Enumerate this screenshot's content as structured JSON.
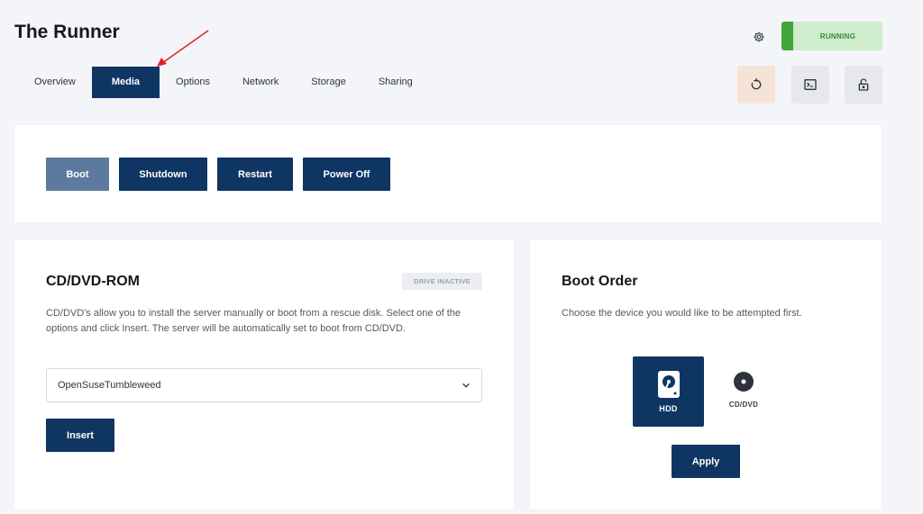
{
  "app": {
    "title": "The Runner"
  },
  "tabs": [
    {
      "label": "Overview",
      "active": false
    },
    {
      "label": "Media",
      "active": true
    },
    {
      "label": "Options",
      "active": false
    },
    {
      "label": "Network",
      "active": false
    },
    {
      "label": "Storage",
      "active": false
    },
    {
      "label": "Sharing",
      "active": false
    }
  ],
  "header": {
    "settings_icon": "gear-icon",
    "status": "RUNNING",
    "actions": [
      {
        "icon": "restart-icon"
      },
      {
        "icon": "console-icon"
      },
      {
        "icon": "lock-icon"
      }
    ]
  },
  "power": {
    "boot": "Boot",
    "shutdown": "Shutdown",
    "restart": "Restart",
    "power_off": "Power Off"
  },
  "cdrom": {
    "title": "CD/DVD-ROM",
    "badge": "DRIVE INACTIVE",
    "description": "CD/DVD's allow you to install the server manually or boot from a rescue disk. Select one of the options and click Insert. The server will be automatically set to boot from CD/DVD.",
    "selected_image": "OpenSuseTumbleweed",
    "insert_label": "Insert"
  },
  "boot_order": {
    "title": "Boot Order",
    "description": "Choose the device you would like to be attempted first.",
    "devices": [
      {
        "label": "HDD",
        "selected": true
      },
      {
        "label": "CD/DVD",
        "selected": false
      }
    ],
    "apply_label": "Apply"
  },
  "colors": {
    "primary": "#0f3563",
    "boot_disabled": "#5c7a9d",
    "status_bg": "#cfeccd",
    "status_bar": "#3fa63c",
    "annotation_arrow": "#e02020"
  }
}
